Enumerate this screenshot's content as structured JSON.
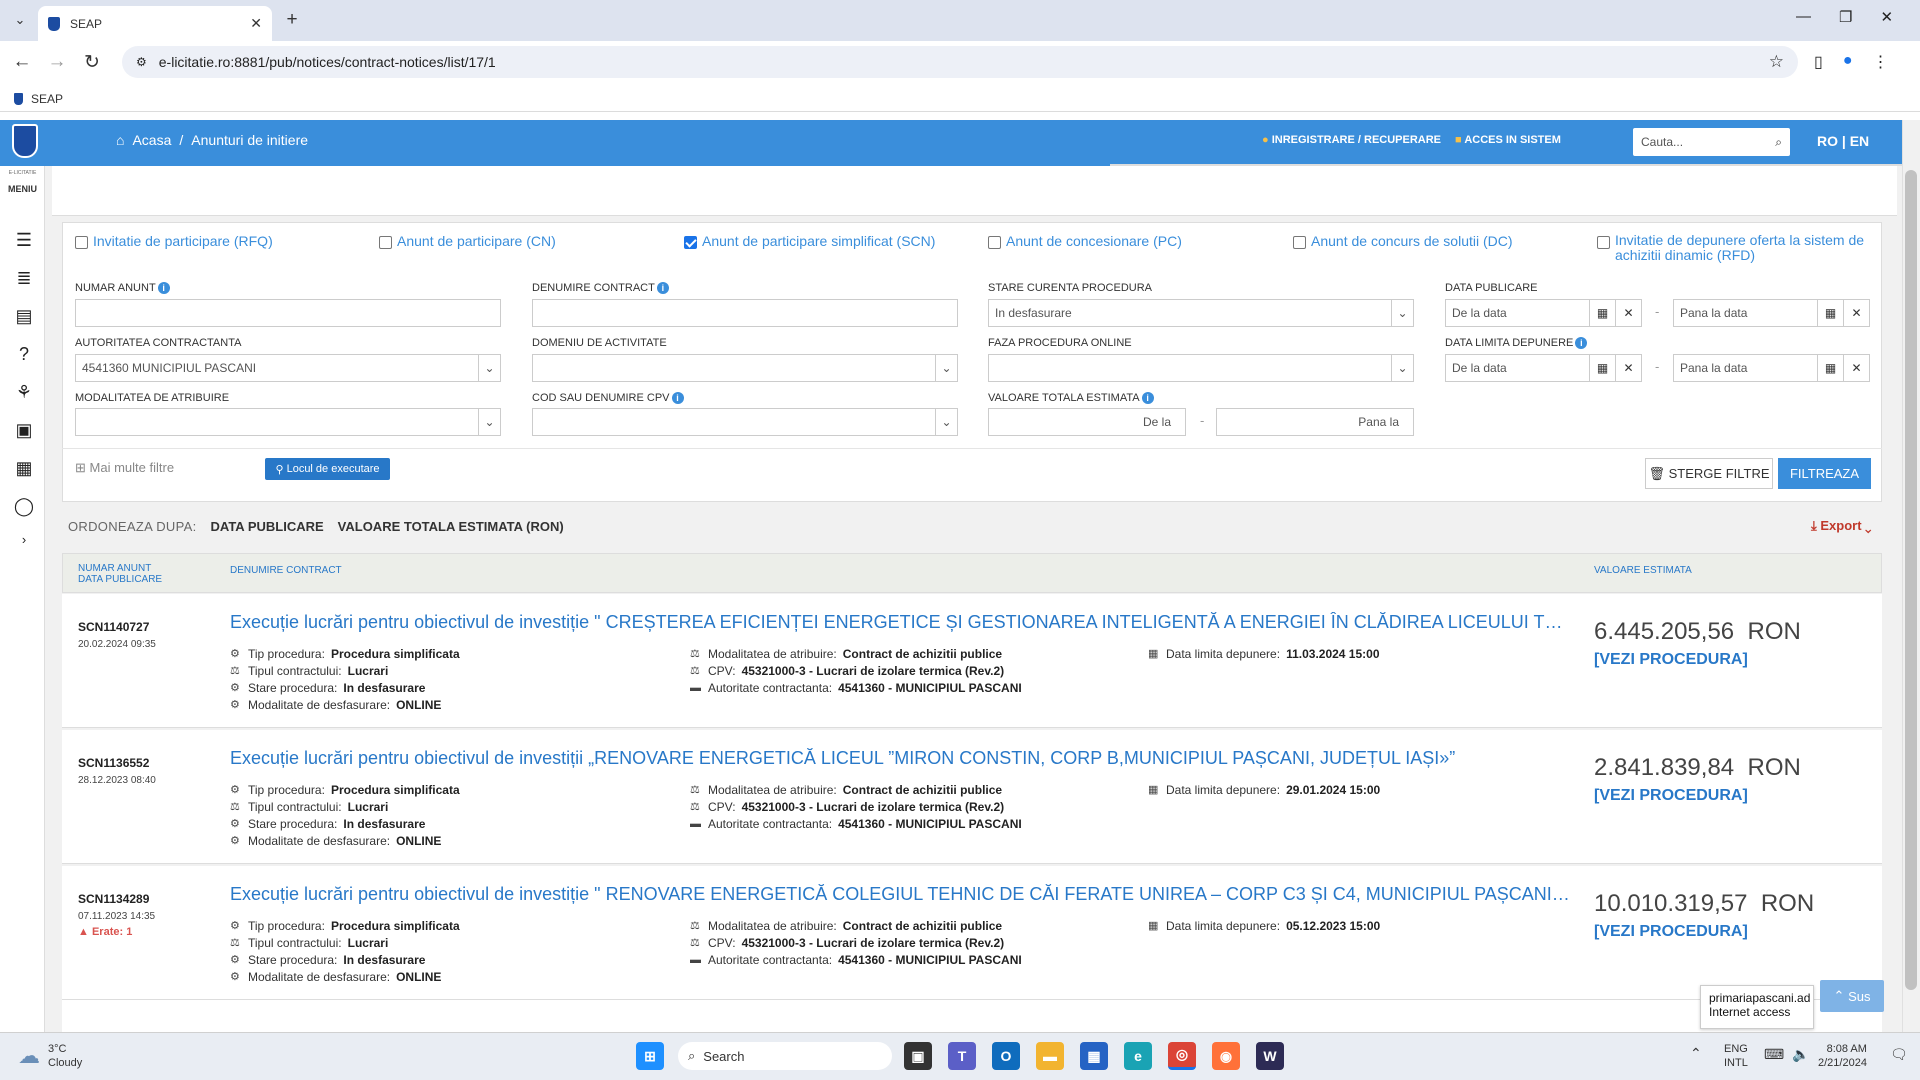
{
  "browser": {
    "tab_title": "SEAP",
    "url": "e-licitatie.ro:8881/pub/notices/contract-notices/list/17/1",
    "bookmark": "SEAP"
  },
  "header": {
    "breadcrumb_home": "Acasa",
    "breadcrumb_sep": "/",
    "breadcrumb_current": "Anunturi de initiere",
    "register": "INREGISTRARE / RECUPERARE",
    "login": "ACCES IN SISTEM",
    "search_placeholder": "Cauta...",
    "lang": "RO | EN"
  },
  "sidebar": {
    "brand": "E-LICITATIE",
    "menu": "MENIU"
  },
  "notice_types": [
    {
      "label": "Invitatie de participare (RFQ)",
      "checked": false
    },
    {
      "label": "Anunt de participare (CN)",
      "checked": false
    },
    {
      "label": "Anunt de participare simplificat (SCN)",
      "checked": true
    },
    {
      "label": "Anunt de concesionare (PC)",
      "checked": false
    },
    {
      "label": "Anunt de concurs de solutii (DC)",
      "checked": false
    },
    {
      "label": "Invitatie de depunere oferta la sistem de achizitii dinamic (RFD)",
      "checked": false
    }
  ],
  "filters": {
    "numar_anunt": "NUMAR ANUNT",
    "denumire_contract": "DENUMIRE CONTRACT",
    "stare_procedura": "STARE CURENTA PROCEDURA",
    "stare_value": "In desfasurare",
    "data_publicare": "DATA PUBLICARE",
    "de_la_data": "De la data",
    "pana_la_data": "Pana la data",
    "autoritate": "AUTORITATEA CONTRACTANTA",
    "autoritate_value": "4541360 MUNICIPIUL PASCANI",
    "domeniu": "DOMENIU DE ACTIVITATE",
    "faza": "FAZA PROCEDURA ONLINE",
    "data_limita": "DATA LIMITA DEPUNERE",
    "modalitate": "MODALITATEA DE ATRIBUIRE",
    "cpv": "COD SAU DENUMIRE CPV",
    "valoare": "VALOARE TOTALA ESTIMATA",
    "de_la": "De la",
    "pana_la": "Pana la",
    "dash": "-",
    "more_filters": "Mai multe filtre",
    "locul": "Locul de executare",
    "clear": "STERGE FILTRE",
    "apply": "FILTREAZA"
  },
  "sort": {
    "label": "ORDONEAZA DUPA:",
    "opt1": "DATA PUBLICARE",
    "opt2": "VALOARE TOTALA ESTIMATA (RON)",
    "export": "Export"
  },
  "table": {
    "col1a": "NUMAR ANUNT",
    "col1b": "DATA PUBLICARE",
    "col2": "DENUMIRE CONTRACT",
    "col3": "VALOARE ESTIMATA"
  },
  "labels": {
    "tip": "Tip procedura:",
    "tipul": "Tipul contractului:",
    "stare": "Stare procedura:",
    "modalitate_desf": "Modalitate de desfasurare:",
    "modalitate_atr": "Modalitatea de atribuire:",
    "cpv": "CPV:",
    "autoritate": "Autoritate contractanta:",
    "data_limita": "Data limita depunere:",
    "vezi": "[VEZI PROCEDURA]",
    "currency": "RON"
  },
  "rows": [
    {
      "id": "SCN1140727",
      "date": "20.02.2024 09:35",
      "error": "",
      "title": "Execuție lucrări pentru obiectivul de investiție \" CREȘTEREA EFICIENȚEI ENERGETICE ȘI GESTIONAREA INTELIGENTĂ A ENERGIEI ÎN CLĂDIREA LICEULUI TEHNOLOGIC...",
      "tip": "Procedura simplificata",
      "tipul": "Lucrari",
      "stare": "In desfasurare",
      "modalitate_desf": "ONLINE",
      "modalitate_atr": "Contract de achizitii publice",
      "cpv": "45321000-3 - Lucrari de izolare termica (Rev.2)",
      "autoritate": "4541360 - MUNICIPIUL PASCANI",
      "data_limita": "11.03.2024 15:00",
      "value": "6.445.205,56"
    },
    {
      "id": "SCN1136552",
      "date": "28.12.2023 08:40",
      "error": "",
      "title": "Execuție lucrări pentru obiectivul de investiții „RENOVARE ENERGETICĂ LICEUL ”MIRON CONSTIN, CORP B,MUNICIPIUL PAȘCANI, JUDEȚUL IAȘI»”",
      "tip": "Procedura simplificata",
      "tipul": "Lucrari",
      "stare": "In desfasurare",
      "modalitate_desf": "ONLINE",
      "modalitate_atr": "Contract de achizitii publice",
      "cpv": "45321000-3 - Lucrari de izolare termica (Rev.2)",
      "autoritate": "4541360 - MUNICIPIUL PASCANI",
      "data_limita": "29.01.2024 15:00",
      "value": "2.841.839,84"
    },
    {
      "id": "SCN1134289",
      "date": "07.11.2023 14:35",
      "error": "Erate: 1",
      "title": "Execuție lucrări pentru obiectivul de investiție \" RENOVARE ENERGETICĂ COLEGIUL TEHNIC DE CĂI FERATE UNIREA – CORP C3 ȘI C4, MUNICIPIUL PAȘCANI, JUDEȚUL IAȘI\"",
      "tip": "Procedura simplificata",
      "tipul": "Lucrari",
      "stare": "In desfasurare",
      "modalitate_desf": "ONLINE",
      "modalitate_atr": "Contract de achizitii publice",
      "cpv": "45321000-3 - Lucrari de izolare termica (Rev.2)",
      "autoritate": "4541360 - MUNICIPIUL PASCANI",
      "data_limita": "05.12.2023 15:00",
      "value": "10.010.319,57"
    }
  ],
  "tooltip": {
    "line1": "primariapascani.ad",
    "line2": "Internet access"
  },
  "sus": "Sus",
  "taskbar": {
    "weather_temp": "3°C",
    "weather_desc": "Cloudy",
    "search": "Search",
    "lang1": "ENG",
    "lang2": "INTL",
    "time": "8:08 AM",
    "date": "2/21/2024"
  },
  "colors": {
    "header": "#3a8edb",
    "link": "#2878c8",
    "error": "#d9534f"
  }
}
